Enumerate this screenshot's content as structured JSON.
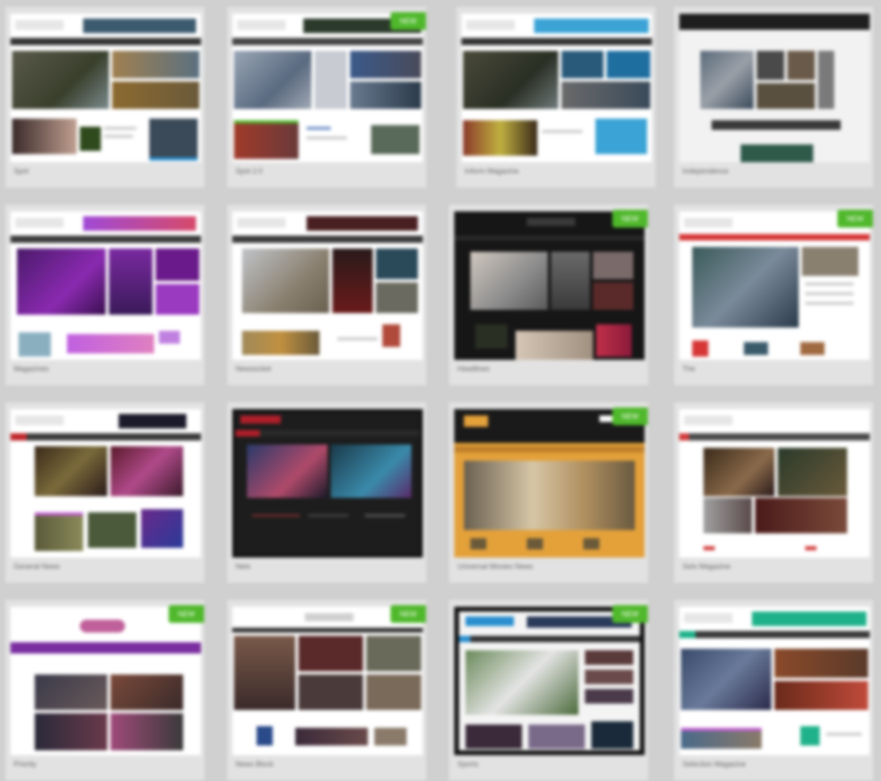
{
  "gallery": {
    "items": [
      {
        "name": "Spot",
        "badge": "",
        "theme": "light",
        "accent": "#2a8fcf"
      },
      {
        "name": "Spot 2.0",
        "badge": "NEW",
        "theme": "light",
        "accent": "#4fb82b"
      },
      {
        "name": "Inform Magazine",
        "badge": "",
        "theme": "light",
        "accent": "#3ba3d6"
      },
      {
        "name": "Independence",
        "badge": "",
        "theme": "light",
        "accent": "#222222"
      },
      {
        "name": "Magazines",
        "badge": "",
        "theme": "light",
        "accent": "#a13bd6"
      },
      {
        "name": "Newsocket",
        "badge": "",
        "theme": "light",
        "accent": "#5a1f22"
      },
      {
        "name": "Headlines",
        "badge": "NEW",
        "theme": "dark",
        "accent": "#4fb82b"
      },
      {
        "name": "The",
        "badge": "NEW",
        "theme": "light",
        "accent": "#d63636"
      },
      {
        "name": "General News",
        "badge": "",
        "theme": "light",
        "accent": "#c0272d"
      },
      {
        "name": "Nets",
        "badge": "",
        "theme": "darkframe",
        "accent": "#b01f2a"
      },
      {
        "name": "Universal Movies News",
        "badge": "NEW",
        "theme": "dark",
        "accent": "#e4a13a"
      },
      {
        "name": "Sets Magazine",
        "badge": "",
        "theme": "light",
        "accent": "#d23b3b"
      },
      {
        "name": "Priority",
        "badge": "NEW",
        "theme": "light",
        "accent": "#7a2ea0"
      },
      {
        "name": "News Block",
        "badge": "NEW",
        "theme": "light",
        "accent": "#333333"
      },
      {
        "name": "Sports",
        "badge": "NEW",
        "theme": "darkframe",
        "accent": "#2a8fcf"
      },
      {
        "name": "Selection Magazine",
        "badge": "",
        "theme": "light",
        "accent": "#1fb28a"
      }
    ]
  }
}
